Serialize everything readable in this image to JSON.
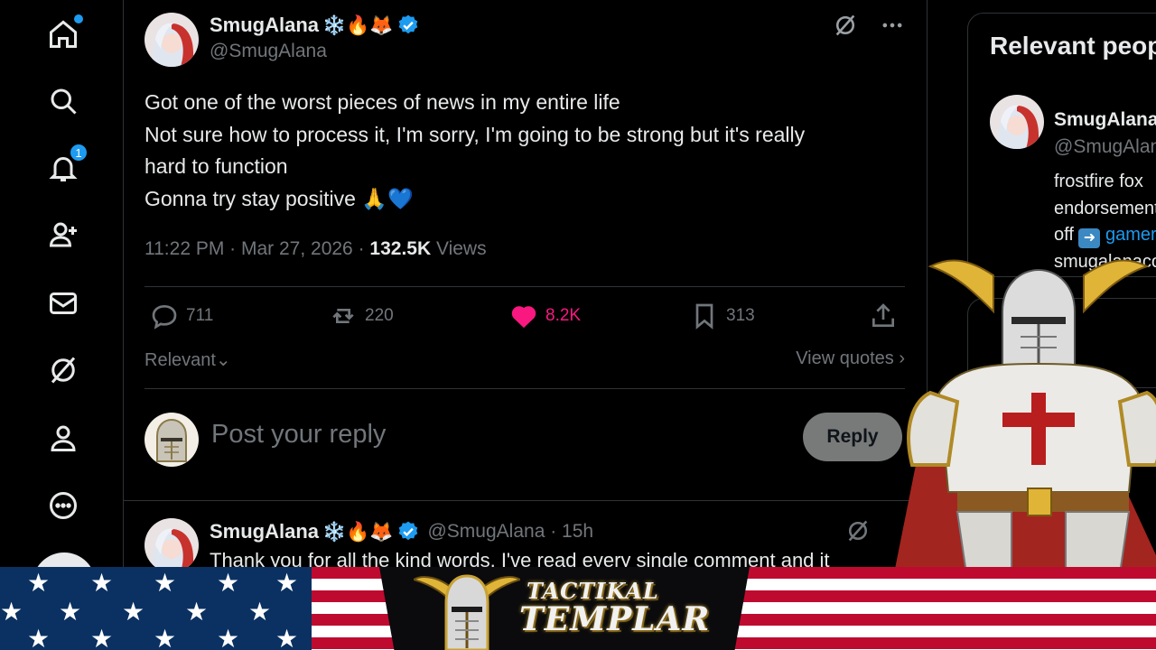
{
  "nav": {
    "items": [
      {
        "icon": "home-icon"
      },
      {
        "icon": "search-icon"
      },
      {
        "icon": "bell-icon",
        "badge": "1"
      },
      {
        "icon": "follow-icon"
      },
      {
        "icon": "mail-icon"
      },
      {
        "icon": "grok-icon"
      },
      {
        "icon": "profile-icon"
      },
      {
        "icon": "more-icon"
      }
    ]
  },
  "post": {
    "author_name": "SmugAlana",
    "author_emojis": "❄️🔥🦊",
    "author_handle": "@SmugAlana",
    "lines": [
      "Got one of the worst pieces of news in my entire life",
      "Not sure how to process it, I'm sorry, I'm going to be strong but it's really",
      "hard to function",
      "Gonna try stay positive 🙏💙"
    ],
    "time": "11:22 PM · Mar 27, 2026 · ",
    "views_count": "132.5K",
    "views_label": " Views",
    "actions": {
      "replies": "711",
      "reposts": "220",
      "likes": "8.2K",
      "bookmarks": "313"
    },
    "sort_label": "Relevant⌄",
    "view_quotes": "View quotes ›"
  },
  "reply_box": {
    "placeholder": "Post your reply",
    "button": "Reply"
  },
  "reply": {
    "author_name": "SmugAlana",
    "author_emojis": "❄️🔥🦊",
    "meta": "@SmugAlana · 15h",
    "text": "Thank you for all the kind words, I've read every single comment and it"
  },
  "sidebar": {
    "title": "Relevant people",
    "person_name": "SmugAlana",
    "person_handle": "@SmugAlana",
    "bio_line1": "frostfire fox",
    "bio_line2": "endorsements",
    "bio_line3_pre": "off ",
    "bio_line3_link": "gamers",
    "bio_line4": "smugalanacos"
  },
  "banner": {
    "logo_line1": "TACTIKAL",
    "logo_line2": "TEMPLAR"
  },
  "colors": {
    "background": "#000000",
    "accent": "#1d9bf0",
    "like": "#f91880",
    "muted": "#71767b"
  }
}
